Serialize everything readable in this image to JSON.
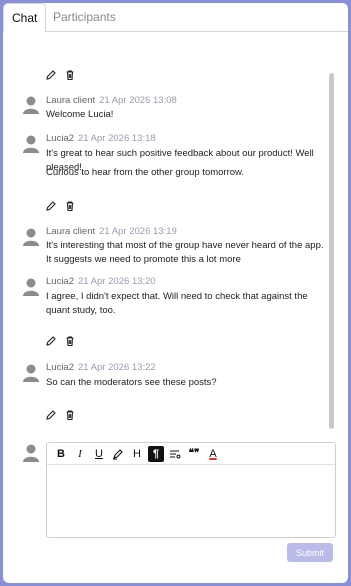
{
  "tabs": [
    {
      "label": "Chat",
      "active": true
    },
    {
      "label": "Participants",
      "active": false
    }
  ],
  "messages": [
    {
      "author": "Laura client",
      "time": "21 Apr 2026 13:08",
      "lines": [
        "Welcome Lucia!"
      ]
    },
    {
      "author": "Lucia2",
      "time": "21 Apr 2026 13:18",
      "lines": [
        "It's great to hear such positive feedback about our product! Well pleased!",
        "Curious to hear from the other group tomorrow."
      ]
    },
    {
      "author": "Laura client",
      "time": "21 Apr 2026 13:19",
      "lines": [
        "It's interesting that most of the group have never heard of the app. It suggests we need to promote this a lot more"
      ]
    },
    {
      "author": "Lucia2",
      "time": "21 Apr 2026 13:20",
      "lines": [
        "I agree, I didn't expect that. Will need to check that against the quant study, too."
      ]
    },
    {
      "author": "Lucia2",
      "time": "21 Apr 2026 13:22",
      "lines": [
        "So can the moderators see these posts?"
      ]
    }
  ],
  "toolbar": {
    "bold": "B",
    "italic": "I",
    "underline": "U",
    "heading": "H",
    "paragraph": "¶",
    "quote": "❝❞",
    "font_color": "A"
  },
  "submit_label": "Submit",
  "colors": {
    "accent": "#8a8fd9",
    "submit_disabled": "#b9bce8",
    "time": "#9a9ab0"
  }
}
